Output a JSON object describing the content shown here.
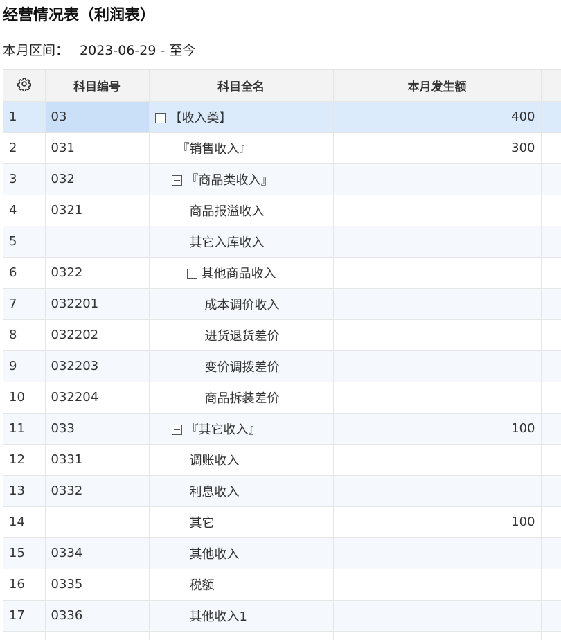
{
  "title": "经营情况表（利润表）",
  "range": {
    "label": "本月区间：",
    "value": "2023-06-29 - 至今"
  },
  "columns": {
    "settings_icon": "gear-icon",
    "code": "科目编号",
    "name": "科目全名",
    "amount": "本月发生额",
    "extra": ""
  },
  "rows": [
    {
      "num": "1",
      "code": "03",
      "name": "【收入类】",
      "amount": "400",
      "collapsible": true,
      "level": 0
    },
    {
      "num": "2",
      "code": "031",
      "name": "『销售收入』",
      "amount": "300",
      "collapsible": false,
      "level": 1
    },
    {
      "num": "3",
      "code": "032",
      "name": "『商品类收入』",
      "amount": "",
      "collapsible": true,
      "level": 1
    },
    {
      "num": "4",
      "code": "0321",
      "name": "商品报溢收入",
      "amount": "",
      "collapsible": false,
      "level": 2
    },
    {
      "num": "5",
      "code": "",
      "name": "其它入库收入",
      "amount": "",
      "collapsible": false,
      "level": 2
    },
    {
      "num": "6",
      "code": "0322",
      "name": "其他商品收入",
      "amount": "",
      "collapsible": true,
      "level": 2
    },
    {
      "num": "7",
      "code": "032201",
      "name": "成本调价收入",
      "amount": "",
      "collapsible": false,
      "level": 3
    },
    {
      "num": "8",
      "code": "032202",
      "name": "进货退货差价",
      "amount": "",
      "collapsible": false,
      "level": 3
    },
    {
      "num": "9",
      "code": "032203",
      "name": "变价调拨差价",
      "amount": "",
      "collapsible": false,
      "level": 3
    },
    {
      "num": "10",
      "code": "032204",
      "name": "商品拆装差价",
      "amount": "",
      "collapsible": false,
      "level": 3
    },
    {
      "num": "11",
      "code": "033",
      "name": "『其它收入』",
      "amount": "100",
      "collapsible": true,
      "level": 1
    },
    {
      "num": "12",
      "code": "0331",
      "name": "调账收入",
      "amount": "",
      "collapsible": false,
      "level": 2
    },
    {
      "num": "13",
      "code": "0332",
      "name": "利息收入",
      "amount": "",
      "collapsible": false,
      "level": 2
    },
    {
      "num": "14",
      "code": "",
      "name": "其它",
      "amount": "100",
      "collapsible": false,
      "level": 2
    },
    {
      "num": "15",
      "code": "0334",
      "name": "其他收入",
      "amount": "",
      "collapsible": false,
      "level": 2
    },
    {
      "num": "16",
      "code": "0335",
      "name": "税额",
      "amount": "",
      "collapsible": false,
      "level": 2
    },
    {
      "num": "17",
      "code": "0336",
      "name": "其他收入1",
      "amount": "",
      "collapsible": false,
      "level": 2
    },
    {
      "num": "",
      "code": "",
      "name": "",
      "amount": "",
      "collapsible": false,
      "level": 0
    }
  ],
  "selected_row": "1"
}
